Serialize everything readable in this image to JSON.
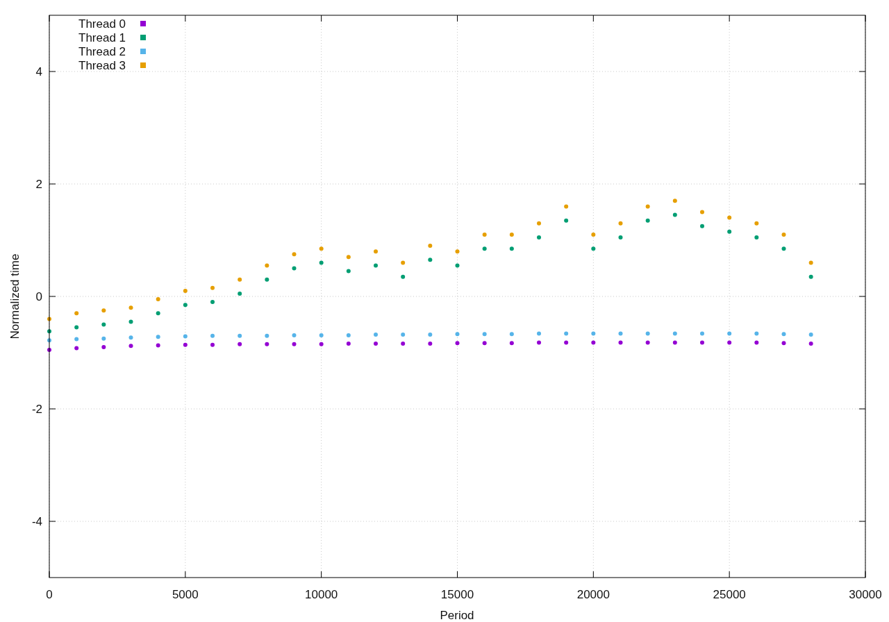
{
  "chart_data": {
    "type": "scatter",
    "xlabel": "Period",
    "ylabel": "Normalized time",
    "x": [
      0,
      1000,
      2000,
      3000,
      4000,
      5000,
      6000,
      7000,
      8000,
      9000,
      10000,
      11000,
      12000,
      13000,
      14000,
      15000,
      16000,
      17000,
      18000,
      19000,
      20000,
      21000,
      22000,
      23000,
      24000,
      25000,
      26000,
      27000,
      28000
    ],
    "series": [
      {
        "name": "Thread 0",
        "color": "#9400d3",
        "values": [
          -0.95,
          -0.92,
          -0.9,
          -0.88,
          -0.87,
          -0.86,
          -0.86,
          -0.85,
          -0.85,
          -0.85,
          -0.85,
          -0.84,
          -0.84,
          -0.84,
          -0.84,
          -0.83,
          -0.83,
          -0.83,
          -0.82,
          -0.82,
          -0.82,
          -0.82,
          -0.82,
          -0.82,
          -0.82,
          -0.82,
          -0.82,
          -0.83,
          -0.84
        ]
      },
      {
        "name": "Thread 1",
        "color": "#009e73",
        "values": [
          -0.62,
          -0.55,
          -0.5,
          -0.45,
          -0.3,
          -0.15,
          -0.1,
          0.05,
          0.3,
          0.5,
          0.6,
          0.45,
          0.55,
          0.35,
          0.65,
          0.55,
          0.85,
          0.85,
          1.05,
          1.35,
          0.85,
          1.05,
          1.35,
          1.45,
          1.25,
          1.15,
          1.05,
          0.85,
          0.35
        ]
      },
      {
        "name": "Thread 2",
        "color": "#56b4e9",
        "values": [
          -0.78,
          -0.76,
          -0.75,
          -0.73,
          -0.72,
          -0.71,
          -0.7,
          -0.7,
          -0.7,
          -0.69,
          -0.69,
          -0.69,
          -0.68,
          -0.68,
          -0.68,
          -0.67,
          -0.67,
          -0.67,
          -0.66,
          -0.66,
          -0.66,
          -0.66,
          -0.66,
          -0.66,
          -0.66,
          -0.66,
          -0.66,
          -0.67,
          -0.68
        ]
      },
      {
        "name": "Thread 3",
        "color": "#e69f00",
        "values": [
          -0.4,
          -0.3,
          -0.25,
          -0.2,
          -0.05,
          0.1,
          0.15,
          0.3,
          0.55,
          0.75,
          0.85,
          0.7,
          0.8,
          0.6,
          0.9,
          0.8,
          1.1,
          1.1,
          1.3,
          1.6,
          1.1,
          1.3,
          1.6,
          1.7,
          1.5,
          1.4,
          1.3,
          1.1,
          0.6
        ]
      }
    ],
    "xlim": [
      0,
      30000
    ],
    "ylim": [
      -5,
      5
    ],
    "xticks": [
      0,
      5000,
      10000,
      15000,
      20000,
      25000,
      30000
    ],
    "yticks": [
      -4,
      -2,
      0,
      2,
      4
    ],
    "grid": true,
    "legend": true
  }
}
